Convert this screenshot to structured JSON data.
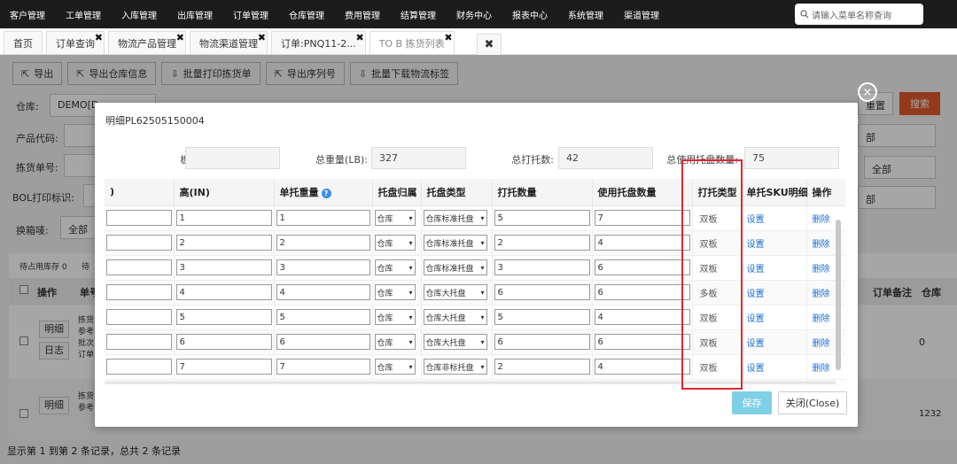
{
  "topnav": {
    "items": [
      "客户管理",
      "工单管理",
      "入库管理",
      "出库管理",
      "订单管理",
      "仓库管理",
      "费用管理",
      "结算管理",
      "财务中心",
      "报表中心",
      "系统管理",
      "渠道管理"
    ],
    "search_placeholder": "请输入菜单名称查询"
  },
  "tabs": [
    {
      "label": "首页",
      "closable": false
    },
    {
      "label": "订单查询",
      "closable": true
    },
    {
      "label": "物流产品管理",
      "closable": true
    },
    {
      "label": "物流渠道管理",
      "closable": true
    },
    {
      "label": "订单:PNQ11-2...",
      "closable": true
    },
    {
      "label": "TO B 拣货列表",
      "closable": true,
      "active": true
    }
  ],
  "toolbar": {
    "buttons": [
      "导出",
      "导出仓库信息",
      "批量打印拣货单",
      "导出序列号",
      "批量下载物流标签"
    ]
  },
  "background": {
    "warehouse_label": "仓库:",
    "warehouse_value": "DEMO[D",
    "product_code_label": "产品代码:",
    "pick_no_label": "拣货单号:",
    "bol_label": "BOL打印标识:",
    "relabel_label": "换箱唛:",
    "relabel_value": "全部",
    "pending_label": "待占用库存 0",
    "pending2_label": "待",
    "all_value": "全部",
    "reset_label": "重置",
    "search_label": "搜索",
    "dept_label": "部",
    "dept2_label": "部",
    "col_ops": "操作",
    "col_no": "单号",
    "col_order_remark": "订单备注",
    "col_warehouse": "仓库",
    "row_detail": "明细",
    "row_log": "日志",
    "row_zero": "0",
    "row_num": "1232",
    "row_text": [
      "拣货",
      "参考",
      "批次",
      "订单"
    ]
  },
  "footer": {
    "text": "显示第 1 到第 2 条记录，总共 2 条记录"
  },
  "modal": {
    "title": "明细PL62505150004",
    "summary": {
      "slot_label": "板位:",
      "slot_value": "",
      "weight_label": "总重量(LB):",
      "weight_value": "327",
      "pallets_label": "总打托数:",
      "pallets_value": "42",
      "used_label": "总使用托盘数量:",
      "used_value": "75"
    },
    "columns": {
      "first": ")",
      "height": "高(IN)",
      "weight": "单托重量",
      "owner": "托盘归属",
      "ptype": "托盘类型",
      "count": "打托数量",
      "used": "使用托盘数量",
      "rtype": "打托类型",
      "sku": "单托SKU明细",
      "op": "操作"
    },
    "rows": [
      {
        "first": "",
        "height": "1",
        "weight": "1",
        "owner": "仓库",
        "ptype": "仓库标准托盘",
        "count": "5",
        "used": "7",
        "rtype": "双板",
        "sku": "设置",
        "op": "删除"
      },
      {
        "first": "",
        "height": "2",
        "weight": "2",
        "owner": "仓库",
        "ptype": "仓库标准托盘",
        "count": "2",
        "used": "4",
        "rtype": "双板",
        "sku": "设置",
        "op": "删除"
      },
      {
        "first": "",
        "height": "3",
        "weight": "3",
        "owner": "仓库",
        "ptype": "仓库标准托盘",
        "count": "3",
        "used": "6",
        "rtype": "双板",
        "sku": "设置",
        "op": "删除"
      },
      {
        "first": "",
        "height": "4",
        "weight": "4",
        "owner": "仓库",
        "ptype": "仓库大托盘",
        "count": "6",
        "used": "6",
        "rtype": "多板",
        "sku": "设置",
        "op": "删除"
      },
      {
        "first": "",
        "height": "5",
        "weight": "5",
        "owner": "仓库",
        "ptype": "仓库大托盘",
        "count": "5",
        "used": "4",
        "rtype": "双板",
        "sku": "设置",
        "op": "删除"
      },
      {
        "first": "",
        "height": "6",
        "weight": "6",
        "owner": "仓库",
        "ptype": "仓库大托盘",
        "count": "6",
        "used": "6",
        "rtype": "双板",
        "sku": "设置",
        "op": "删除"
      },
      {
        "first": "",
        "height": "7",
        "weight": "7",
        "owner": "仓库",
        "ptype": "仓库非标托盘",
        "count": "2",
        "used": "4",
        "rtype": "双板",
        "sku": "设置",
        "op": "删除"
      }
    ],
    "save_label": "保存",
    "close_label": "关闭(Close)"
  }
}
